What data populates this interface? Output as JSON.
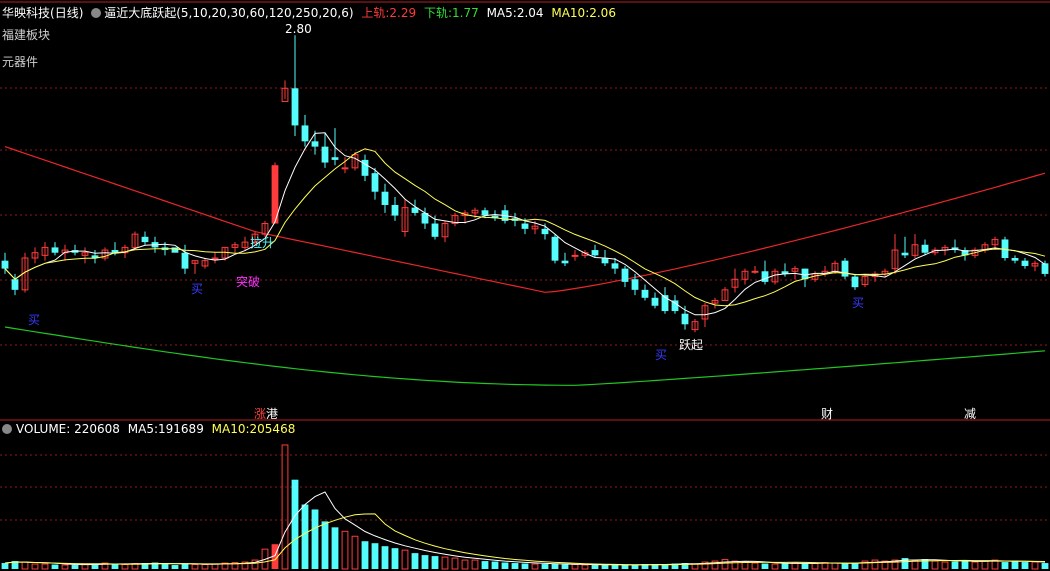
{
  "header": {
    "stock": "华映科技",
    "period": "(日线)",
    "indicator": "逼近大底跃起",
    "params": "(5,10,20,30,60,120,250,20,6)",
    "upper_label": "上轨:",
    "upper_value": "2.29",
    "lower_label": "下轨:",
    "lower_value": "1.77",
    "ma5_label": "MA5:",
    "ma5_value": "2.04",
    "ma10_label": "MA10:",
    "ma10_value": "2.06"
  },
  "sidebar": {
    "sector": "福建板块",
    "industry": "元器件"
  },
  "markers": {
    "high_price": "2.80",
    "lashen": "拉升",
    "tupo": "突破",
    "yueqi": "跃起",
    "buy": "买",
    "event_up": "涨",
    "event_hk": "港",
    "event_cai": "财",
    "event_jian": "减"
  },
  "volume_header": {
    "label": "VOLUME:",
    "value": "220608",
    "ma5_label": "MA5:",
    "ma5_value": "191689",
    "ma10_label": "MA10:",
    "ma10_value": "205468"
  },
  "colors": {
    "up": "#ff3b3b",
    "down": "#54fcfc",
    "ma5": "#ffffff",
    "ma10": "#ffff55",
    "upper": "#e8262a",
    "lower": "#22c522",
    "grid": "#8b1a1a",
    "buy": "#3a3aff",
    "tupo": "#ff33ff",
    "event_red": "#ff4040"
  },
  "chart_data": {
    "type": "candlestick",
    "price_range": [
      1.5,
      2.85
    ],
    "candles": [
      [
        1.95,
        1.98,
        1.9,
        1.92
      ],
      [
        1.88,
        1.9,
        1.82,
        1.84
      ],
      [
        1.84,
        1.98,
        1.83,
        1.96
      ],
      [
        1.96,
        2.0,
        1.94,
        1.98
      ],
      [
        1.97,
        2.02,
        1.95,
        2.0
      ],
      [
        2.0,
        2.02,
        1.97,
        1.98
      ],
      [
        1.98,
        2.01,
        1.95,
        1.99
      ],
      [
        1.99,
        2.01,
        1.97,
        1.98
      ],
      [
        1.97,
        2.0,
        1.94,
        1.98
      ],
      [
        1.97,
        1.99,
        1.94,
        1.96
      ],
      [
        1.96,
        2.0,
        1.95,
        1.99
      ],
      [
        1.99,
        2.02,
        1.97,
        1.98
      ],
      [
        1.98,
        2.01,
        1.96,
        2.0
      ],
      [
        2.0,
        2.06,
        1.99,
        2.05
      ],
      [
        2.04,
        2.06,
        2.01,
        2.02
      ],
      [
        2.02,
        2.04,
        1.98,
        2.0
      ],
      [
        2.0,
        2.02,
        1.97,
        1.99
      ],
      [
        2.0,
        1.97,
        1.97,
        1.98
      ],
      [
        1.98,
        2.01,
        1.9,
        1.92
      ],
      [
        1.94,
        1.95,
        1.9,
        1.95
      ],
      [
        1.93,
        1.96,
        1.92,
        1.95
      ],
      [
        1.96,
        1.98,
        1.94,
        1.96
      ],
      [
        1.96,
        2.0,
        1.95,
        2.0
      ],
      [
        2.0,
        2.02,
        1.98,
        2.01
      ],
      [
        2.0,
        2.04,
        1.99,
        2.02
      ],
      [
        2.02,
        2.06,
        2.01,
        2.05
      ],
      [
        2.05,
        2.1,
        2.04,
        2.09
      ],
      [
        2.09,
        2.32,
        2.09,
        2.31
      ],
      [
        2.55,
        2.63,
        2.56,
        2.6
      ],
      [
        2.6,
        2.8,
        2.42,
        2.46
      ],
      [
        2.46,
        2.5,
        2.38,
        2.4
      ],
      [
        2.4,
        2.44,
        2.35,
        2.38
      ],
      [
        2.38,
        2.43,
        2.3,
        2.32
      ],
      [
        2.34,
        2.45,
        2.31,
        2.33
      ],
      [
        2.3,
        2.34,
        2.28,
        2.3
      ],
      [
        2.3,
        2.36,
        2.29,
        2.35
      ],
      [
        2.33,
        2.35,
        2.25,
        2.27
      ],
      [
        2.28,
        2.3,
        2.18,
        2.21
      ],
      [
        2.21,
        2.24,
        2.13,
        2.16
      ],
      [
        2.16,
        2.19,
        2.1,
        2.12
      ],
      [
        2.06,
        2.18,
        2.04,
        2.15
      ],
      [
        2.15,
        2.18,
        2.12,
        2.13
      ],
      [
        2.13,
        2.15,
        2.07,
        2.09
      ],
      [
        2.09,
        2.12,
        2.03,
        2.04
      ],
      [
        2.04,
        2.1,
        2.02,
        2.09
      ],
      [
        2.09,
        2.13,
        2.08,
        2.12
      ],
      [
        2.12,
        2.14,
        2.09,
        2.13
      ],
      [
        2.13,
        2.15,
        2.11,
        2.14
      ],
      [
        2.14,
        2.15,
        2.11,
        2.12
      ],
      [
        2.12,
        2.14,
        2.1,
        2.11
      ],
      [
        2.14,
        2.16,
        2.09,
        2.1
      ],
      [
        2.11,
        2.13,
        2.08,
        2.1
      ],
      [
        2.09,
        2.11,
        2.05,
        2.07
      ],
      [
        2.07,
        2.1,
        2.05,
        2.08
      ],
      [
        2.07,
        2.09,
        2.03,
        2.05
      ],
      [
        2.04,
        2.05,
        1.94,
        1.95
      ],
      [
        1.95,
        1.98,
        1.93,
        1.94
      ],
      [
        1.97,
        1.99,
        1.95,
        1.97
      ],
      [
        1.97,
        1.99,
        1.96,
        1.98
      ],
      [
        1.99,
        2.01,
        1.96,
        1.97
      ],
      [
        1.96,
        1.99,
        1.93,
        1.94
      ],
      [
        1.94,
        1.96,
        1.9,
        1.92
      ],
      [
        1.92,
        1.93,
        1.85,
        1.87
      ],
      [
        1.88,
        1.9,
        1.82,
        1.84
      ],
      [
        1.84,
        1.86,
        1.8,
        1.81
      ],
      [
        1.81,
        1.83,
        1.77,
        1.78
      ],
      [
        1.82,
        1.85,
        1.75,
        1.76
      ],
      [
        1.8,
        1.82,
        1.75,
        1.76
      ],
      [
        1.75,
        1.78,
        1.69,
        1.71
      ],
      [
        1.69,
        1.73,
        1.68,
        1.72
      ],
      [
        1.73,
        1.79,
        1.7,
        1.78
      ],
      [
        1.79,
        1.81,
        1.77,
        1.8
      ],
      [
        1.8,
        1.85,
        1.8,
        1.84
      ],
      [
        1.85,
        1.92,
        1.83,
        1.88
      ],
      [
        1.88,
        1.92,
        1.86,
        1.91
      ],
      [
        1.91,
        1.93,
        1.9,
        1.91
      ],
      [
        1.91,
        1.95,
        1.86,
        1.87
      ],
      [
        1.87,
        1.92,
        1.86,
        1.91
      ],
      [
        1.91,
        1.94,
        1.89,
        1.9
      ],
      [
        1.91,
        1.93,
        1.88,
        1.92
      ],
      [
        1.92,
        1.92,
        1.85,
        1.88
      ],
      [
        1.88,
        1.91,
        1.87,
        1.9
      ],
      [
        1.9,
        1.93,
        1.89,
        1.91
      ],
      [
        1.91,
        1.95,
        1.9,
        1.94
      ],
      [
        1.95,
        1.96,
        1.88,
        1.89
      ],
      [
        1.89,
        1.9,
        1.84,
        1.85
      ],
      [
        1.86,
        1.9,
        1.85,
        1.89
      ],
      [
        1.89,
        1.91,
        1.87,
        1.9
      ],
      [
        1.9,
        1.92,
        1.89,
        1.91
      ],
      [
        1.92,
        2.05,
        1.9,
        1.99
      ],
      [
        1.98,
        2.04,
        1.96,
        1.97
      ],
      [
        1.97,
        2.05,
        1.96,
        2.01
      ],
      [
        2.01,
        2.03,
        1.97,
        1.98
      ],
      [
        1.98,
        2.0,
        1.97,
        1.99
      ],
      [
        1.99,
        2.01,
        1.97,
        2.0
      ],
      [
        2.0,
        2.03,
        1.98,
        1.99
      ],
      [
        1.99,
        2.0,
        1.95,
        1.97
      ],
      [
        1.97,
        2.0,
        1.96,
        1.99
      ],
      [
        1.99,
        2.02,
        1.98,
        2.01
      ],
      [
        2.01,
        2.04,
        1.99,
        2.03
      ],
      [
        2.03,
        2.04,
        1.95,
        1.96
      ],
      [
        1.96,
        1.97,
        1.94,
        1.95
      ],
      [
        1.95,
        1.96,
        1.92,
        1.93
      ],
      [
        1.93,
        1.95,
        1.91,
        1.94
      ],
      [
        1.94,
        1.95,
        1.89,
        1.9
      ]
    ],
    "volume_range": [
      0,
      1300000
    ],
    "volumes": [
      60000,
      80000,
      70000,
      50000,
      50000,
      45000,
      40000,
      40000,
      45000,
      55000,
      60000,
      50000,
      45000,
      55000,
      60000,
      65000,
      50000,
      40000,
      55000,
      45000,
      45000,
      50000,
      60000,
      65000,
      70000,
      90000,
      200000,
      250000,
      1250000,
      900000,
      650000,
      600000,
      480000,
      420000,
      380000,
      330000,
      280000,
      260000,
      230000,
      210000,
      190000,
      160000,
      140000,
      130000,
      120000,
      110000,
      90000,
      90000,
      80000,
      75000,
      65000,
      60000,
      55000,
      50000,
      50000,
      50000,
      45000,
      45000,
      40000,
      40000,
      45000,
      40000,
      40000,
      40000,
      50000,
      50000,
      45000,
      55000,
      60000,
      50000,
      70000,
      80000,
      95000,
      80000,
      70000,
      60000,
      55000,
      50000,
      55000,
      60000,
      60000,
      55000,
      65000,
      60000,
      55000,
      60000,
      80000,
      90000,
      80000,
      90000,
      110000,
      85000,
      100000,
      80000,
      70000,
      75000,
      90000,
      70000,
      80000,
      90000,
      70000,
      80000,
      70000,
      70000,
      60000
    ],
    "upper_band": [
      2.38,
      2.19
    ],
    "upper_band_end": 2.28,
    "lower_band": [
      1.7,
      1.48
    ],
    "lower_band_end": 1.61
  }
}
